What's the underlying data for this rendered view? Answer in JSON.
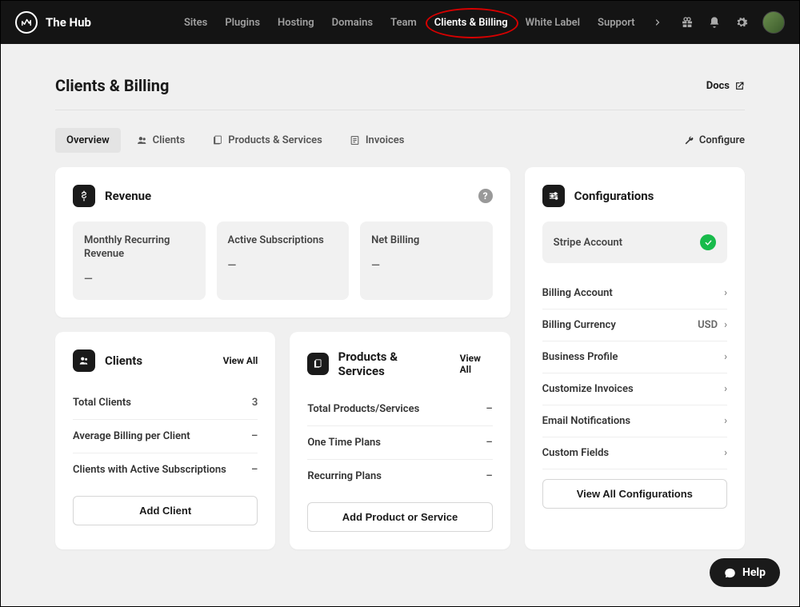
{
  "brand": "The Hub",
  "nav": {
    "items": [
      "Sites",
      "Plugins",
      "Hosting",
      "Domains",
      "Team",
      "Clients & Billing",
      "White Label",
      "Support"
    ],
    "activeIndex": 5
  },
  "header": {
    "title": "Clients & Billing",
    "docs": "Docs"
  },
  "tabs": {
    "items": [
      {
        "label": "Overview"
      },
      {
        "label": "Clients"
      },
      {
        "label": "Products & Services"
      },
      {
        "label": "Invoices"
      }
    ],
    "activeIndex": 0,
    "configure": "Configure"
  },
  "revenue": {
    "title": "Revenue",
    "tiles": [
      {
        "label": "Monthly Recurring Revenue",
        "value": "—"
      },
      {
        "label": "Active Subscriptions",
        "value": "—"
      },
      {
        "label": "Net Billing",
        "value": "—"
      }
    ]
  },
  "clients": {
    "title": "Clients",
    "viewAll": "View All",
    "rows": [
      {
        "label": "Total Clients",
        "value": "3"
      },
      {
        "label": "Average Billing per Client",
        "value": "–"
      },
      {
        "label": "Clients with Active Subscriptions",
        "value": "–"
      }
    ],
    "button": "Add Client"
  },
  "products": {
    "title": "Products & Services",
    "viewAll": "View All",
    "rows": [
      {
        "label": "Total Products/Services",
        "value": "–"
      },
      {
        "label": "One Time Plans",
        "value": "–"
      },
      {
        "label": "Recurring Plans",
        "value": "–"
      }
    ],
    "button": "Add Product or Service"
  },
  "config": {
    "title": "Configurations",
    "stripe": {
      "label": "Stripe Account",
      "status": "connected"
    },
    "rows": [
      {
        "label": "Billing Account",
        "value": ""
      },
      {
        "label": "Billing Currency",
        "value": "USD"
      },
      {
        "label": "Business Profile",
        "value": ""
      },
      {
        "label": "Customize Invoices",
        "value": ""
      },
      {
        "label": "Email Notifications",
        "value": ""
      },
      {
        "label": "Custom Fields",
        "value": ""
      }
    ],
    "button": "View All Configurations"
  },
  "help": "Help"
}
